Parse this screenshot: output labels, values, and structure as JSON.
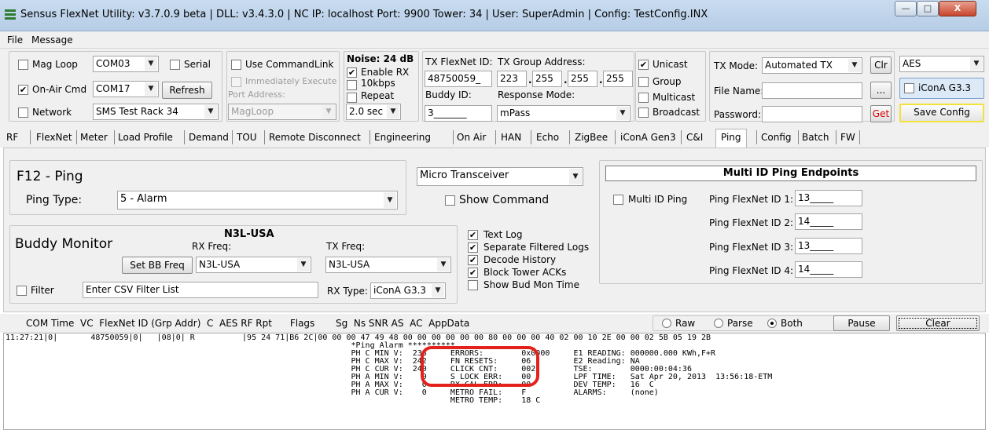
{
  "window": {
    "title": "Sensus FlexNet Utility: v3.7.0.9 beta | DLL: v3.4.3.0 | NC IP: localhost  Port: 9900  Tower:  34 | User: SuperAdmin | Config: TestConfig.INX",
    "min_glyph": "—",
    "max_glyph": "□",
    "close_glyph": "X"
  },
  "menu": [
    "File",
    "Message"
  ],
  "config": {
    "mag_loop": {
      "label": "Mag Loop",
      "port": "COM03",
      "checked": false
    },
    "serial_label": "Serial",
    "on_air_cmd": {
      "label": "On-Air Cmd",
      "port": "COM17",
      "checked": true
    },
    "refresh_label": "Refresh",
    "network": {
      "label": "Network",
      "value": "SMS Test Rack 34"
    },
    "use_commandlink_label": "Use CommandLink",
    "immediately_execute_label": "Immediately Execute",
    "port_address_label": "Port Address:",
    "port_address_value": "MagLoop",
    "noise_label": "Noise: 24 dB",
    "enable_rx_label": "Enable RX",
    "kbps_label": "10kbps",
    "repeat_label": "Repeat",
    "interval": "2.0 sec",
    "tx_flexnet_id_label": "TX FlexNet ID:",
    "tx_flexnet_id": "48750059_",
    "buddy_id_label": "Buddy ID:",
    "buddy_id": "3_______",
    "tx_group_address_label": "TX Group Address:",
    "group_octets": [
      "223",
      "255",
      "255",
      "255"
    ],
    "octet_sep": ".",
    "response_mode_label": "Response Mode:",
    "response_mode": "mPass",
    "unicast_label": "Unicast",
    "group_label": "Group",
    "multicast_label": "Multicast",
    "broadcast_label": "Broadcast",
    "tx_mode_label": "TX Mode:",
    "tx_mode": "Automated TX",
    "clr_label": "Clr",
    "file_name_label": "File Name:",
    "browse_label": "...",
    "password_label": "Password:",
    "get_label": "Get",
    "encryption": "AES",
    "icona_label": "iConA G3.3",
    "save_config_label": "Save Config",
    "check_glyph": "✔"
  },
  "tabs": [
    "RF",
    "FlexNet",
    "Meter",
    "Load Profile",
    "Demand",
    "TOU",
    "Remote Disconnect",
    "Engineering",
    "On Air",
    "HAN",
    "Echo",
    "ZigBee",
    "iConA Gen3",
    "C&I",
    "Ping",
    "Config",
    "Batch",
    "FW"
  ],
  "active_tab": "Ping",
  "ping": {
    "title": "F12 - Ping",
    "ping_type_label": "Ping Type:",
    "ping_type": "5 - Alarm",
    "transceiver": "Micro Transceiver",
    "show_command_label": "Show Command"
  },
  "multi_id": {
    "title": "Multi ID Ping Endpoints",
    "checkbox_label": "Multi ID Ping",
    "rows": [
      {
        "label": "Ping FlexNet ID 1:",
        "value": "13_____"
      },
      {
        "label": "Ping FlexNet ID 2:",
        "value": "14_____"
      },
      {
        "label": "Ping FlexNet ID 3:",
        "value": "13_____"
      },
      {
        "label": "Ping FlexNet ID 4:",
        "value": "14_____"
      }
    ]
  },
  "buddy": {
    "title": "Buddy Monitor",
    "region": "N3L-USA",
    "rx_freq_label": "RX Freq:",
    "tx_freq_label": "TX Freq:",
    "set_bb_freq_label": "Set BB Freq",
    "rx_freq": "N3L-USA",
    "tx_freq": "N3L-USA",
    "filter_label": "Filter",
    "filter_value": "Enter CSV Filter List",
    "rx_type_label": "RX Type:",
    "rx_type": "iConA G3.3",
    "options": [
      {
        "label": "Text Log",
        "checked": true
      },
      {
        "label": "Separate Filtered Logs",
        "checked": true
      },
      {
        "label": "Decode History",
        "checked": true
      },
      {
        "label": "Block Tower ACKs",
        "checked": true
      },
      {
        "label": "Show Bud Mon Time",
        "checked": false
      }
    ]
  },
  "log": {
    "columns": "COM Time  VC  FlexNet ID (Grp Addr)  C  AES RF Rpt      Flags       Sg  Ns SNR AS  AC  AppData",
    "raw_label": "Raw",
    "parse_label": "Parse",
    "both_label": "Both",
    "pause_label": "Pause",
    "clear_label": "Clear",
    "lines": [
      "11:27:21|0|       48750059|0|   |08|0| R          |95 24 71|B6 2C|00 00 00 47 49 48 00 00 00 00 00 00 80 00 00 00 40 02 00 10 2E 00 00 02 5B 05 19 2B",
      "                                                                         *Ping Alarm **********",
      "                                                                         PH C MIN V:  238     ERRORS:        0x0000     E1 READING: 000000.000 KWh,F+R",
      "                                                                         PH C MAX V:  242     FN RESETS:     06         E2 Reading: NA",
      "                                                                         PH C CUR V:  240     CLICK CNT:     002        TSE:        0000:00:04:36",
      "                                                                         PH A MIN V:    0     S LOCK ERR:    00         LPF TIME:   Sat Apr 20, 2013  13:56:18-ETM",
      "                                                                         PH A MAX V:    0     RX CAL ERR:    00         DEV TEMP:   16  C",
      "                                                                         PH A CUR V:    0     METRO FAIL:    F          ALARMS:     (none)",
      "                                                                                              METRO TEMP:    18 C"
    ]
  }
}
